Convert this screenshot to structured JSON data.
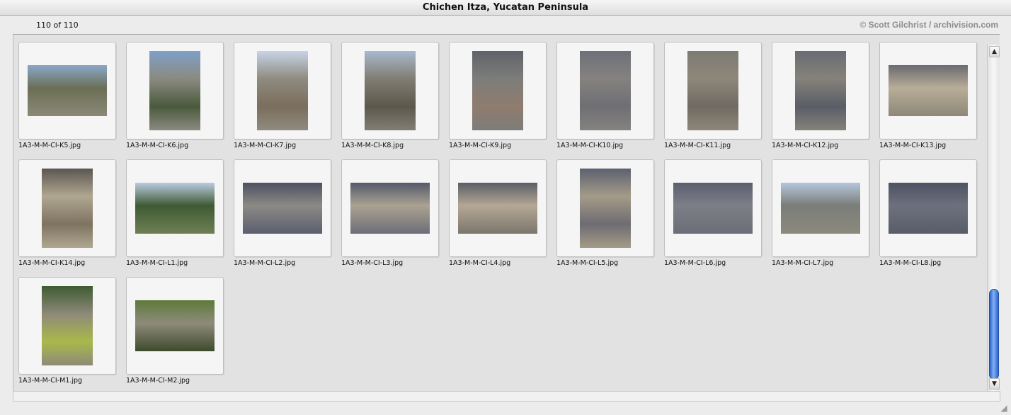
{
  "window": {
    "title": "Chichen Itza, Yucatan Peninsula"
  },
  "header": {
    "count_text": "110 of 110",
    "credit": "© Scott Gilchrist / archivision.com"
  },
  "items": [
    {
      "filename": "1A3-M-M-CI-K5.jpg",
      "orientation": "landscape",
      "palette": [
        "#8aa7c9",
        "#6b6f55",
        "#8b8877"
      ]
    },
    {
      "filename": "1A3-M-M-CI-K6.jpg",
      "orientation": "portrait",
      "palette": [
        "#7fa0c8",
        "#8b8a80",
        "#4a5a3d"
      ]
    },
    {
      "filename": "1A3-M-M-CI-K7.jpg",
      "orientation": "portrait",
      "palette": [
        "#c7d4e6",
        "#8f8b80",
        "#7a6e5c"
      ]
    },
    {
      "filename": "1A3-M-M-CI-K8.jpg",
      "orientation": "portrait",
      "palette": [
        "#a9b9cf",
        "#807d72",
        "#5c584c"
      ]
    },
    {
      "filename": "1A3-M-M-CI-K9.jpg",
      "orientation": "portrait",
      "palette": [
        "#5f6268",
        "#7d7d7a",
        "#8f7c6e"
      ]
    },
    {
      "filename": "1A3-M-M-CI-K10.jpg",
      "orientation": "portrait",
      "palette": [
        "#6d7078",
        "#85827f",
        "#6e6f73"
      ]
    },
    {
      "filename": "1A3-M-M-CI-K11.jpg",
      "orientation": "portrait",
      "palette": [
        "#7e7b74",
        "#8e8679",
        "#6f6b63"
      ]
    },
    {
      "filename": "1A3-M-M-CI-K12.jpg",
      "orientation": "portrait",
      "palette": [
        "#696c73",
        "#85827a",
        "#5a5d66"
      ]
    },
    {
      "filename": "1A3-M-M-CI-K13.jpg",
      "orientation": "landscape",
      "palette": [
        "#6a6a70",
        "#b8ad98",
        "#8e8778"
      ]
    },
    {
      "filename": "1A3-M-M-CI-K14.jpg",
      "orientation": "portrait",
      "palette": [
        "#5b5650",
        "#b0a791",
        "#7d7360"
      ]
    },
    {
      "filename": "1A3-M-M-CI-L1.jpg",
      "orientation": "landscape",
      "palette": [
        "#b9cbe0",
        "#3f5a33",
        "#6f7f54"
      ]
    },
    {
      "filename": "1A3-M-M-CI-L2.jpg",
      "orientation": "landscape",
      "palette": [
        "#4d5160",
        "#8c8a86",
        "#5a5e6e"
      ]
    },
    {
      "filename": "1A3-M-M-CI-L3.jpg",
      "orientation": "landscape",
      "palette": [
        "#55596a",
        "#aaa292",
        "#6d6d78"
      ]
    },
    {
      "filename": "1A3-M-M-CI-L4.jpg",
      "orientation": "landscape",
      "palette": [
        "#5c5d66",
        "#b4a894",
        "#7b766d"
      ]
    },
    {
      "filename": "1A3-M-M-CI-L5.jpg",
      "orientation": "portrait",
      "palette": [
        "#5c6070",
        "#a49b88",
        "#6e6c72"
      ]
    },
    {
      "filename": "1A3-M-M-CI-L6.jpg",
      "orientation": "landscape",
      "palette": [
        "#5a5f6f",
        "#7d7f87",
        "#6b6e78"
      ]
    },
    {
      "filename": "1A3-M-M-CI-L7.jpg",
      "orientation": "landscape",
      "palette": [
        "#b5c6dc",
        "#7a7d78",
        "#8d8a7e"
      ]
    },
    {
      "filename": "1A3-M-M-CI-L8.jpg",
      "orientation": "landscape",
      "palette": [
        "#4e5262",
        "#6d707d",
        "#595c69"
      ]
    },
    {
      "filename": "1A3-M-M-CI-M1.jpg",
      "orientation": "portrait",
      "palette": [
        "#3f5a33",
        "#8e8a78",
        "#a9b94a"
      ]
    },
    {
      "filename": "1A3-M-M-CI-M2.jpg",
      "orientation": "landscape",
      "palette": [
        "#5d7a3a",
        "#8e8b7a",
        "#3d4a2c"
      ]
    }
  ]
}
